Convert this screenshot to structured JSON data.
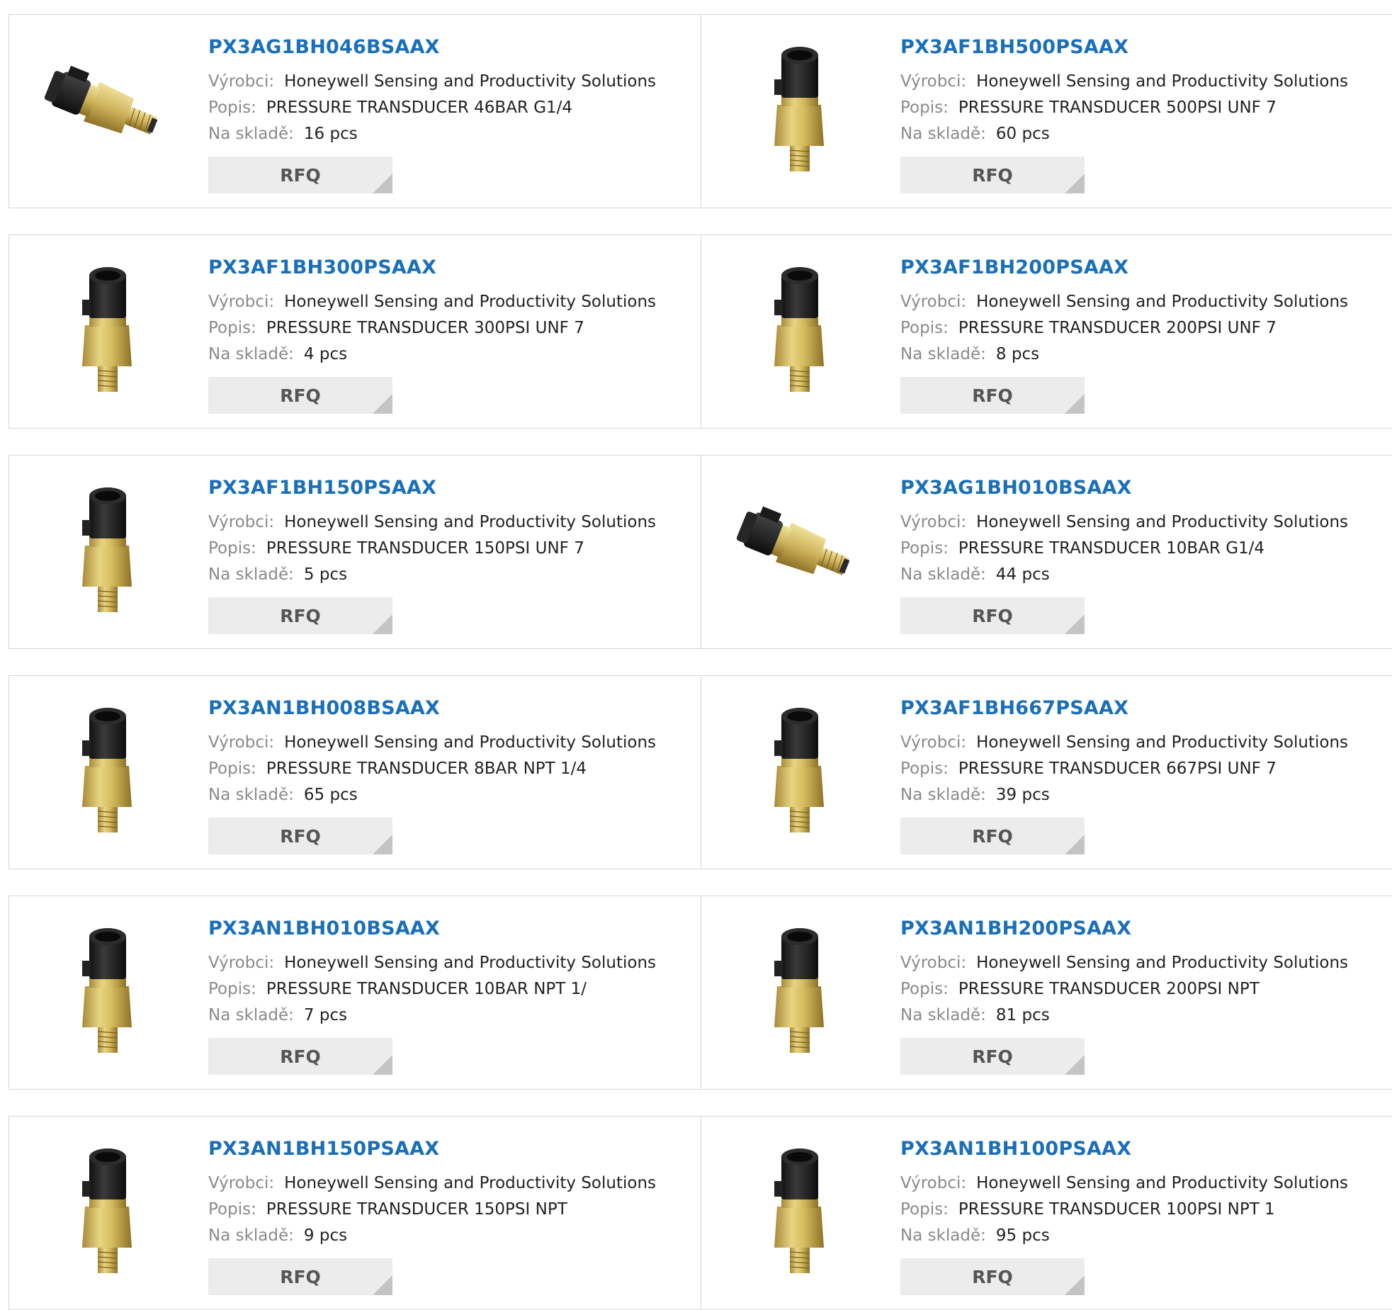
{
  "labels": {
    "manufacturer": "Výrobci:",
    "description": "Popis:",
    "stock": "Na skladě:",
    "rfq": "RFQ"
  },
  "products": [
    {
      "pn": "PX3AG1BH046BSAAX",
      "manufacturer": "Honeywell Sensing and Productivity Solutions",
      "description": "PRESSURE TRANSDUCER 46BAR G1/4",
      "stock": "16 pcs",
      "image": "pressure-sensor-side"
    },
    {
      "pn": "PX3AF1BH500PSAAX",
      "manufacturer": "Honeywell Sensing and Productivity Solutions",
      "description": "PRESSURE TRANSDUCER 500PSI UNF 7",
      "stock": "60 pcs",
      "image": "pressure-sensor-upright"
    },
    {
      "pn": "PX3AF1BH300PSAAX",
      "manufacturer": "Honeywell Sensing and Productivity Solutions",
      "description": "PRESSURE TRANSDUCER 300PSI UNF 7",
      "stock": "4 pcs",
      "image": "pressure-sensor-upright"
    },
    {
      "pn": "PX3AF1BH200PSAAX",
      "manufacturer": "Honeywell Sensing and Productivity Solutions",
      "description": "PRESSURE TRANSDUCER 200PSI UNF 7",
      "stock": "8 pcs",
      "image": "pressure-sensor-upright"
    },
    {
      "pn": "PX3AF1BH150PSAAX",
      "manufacturer": "Honeywell Sensing and Productivity Solutions",
      "description": "PRESSURE TRANSDUCER 150PSI UNF 7",
      "stock": "5 pcs",
      "image": "pressure-sensor-upright"
    },
    {
      "pn": "PX3AG1BH010BSAAX",
      "manufacturer": "Honeywell Sensing and Productivity Solutions",
      "description": "PRESSURE TRANSDUCER 10BAR G1/4",
      "stock": "44 pcs",
      "image": "pressure-sensor-side"
    },
    {
      "pn": "PX3AN1BH008BSAAX",
      "manufacturer": "Honeywell Sensing and Productivity Solutions",
      "description": "PRESSURE TRANSDUCER 8BAR NPT 1/4",
      "stock": "65 pcs",
      "image": "pressure-sensor-upright"
    },
    {
      "pn": "PX3AF1BH667PSAAX",
      "manufacturer": "Honeywell Sensing and Productivity Solutions",
      "description": "PRESSURE TRANSDUCER 667PSI UNF 7",
      "stock": "39 pcs",
      "image": "pressure-sensor-upright"
    },
    {
      "pn": "PX3AN1BH010BSAAX",
      "manufacturer": "Honeywell Sensing and Productivity Solutions",
      "description": "PRESSURE TRANSDUCER 10BAR NPT 1/",
      "stock": "7 pcs",
      "image": "pressure-sensor-upright"
    },
    {
      "pn": "PX3AN1BH200PSAAX",
      "manufacturer": "Honeywell Sensing and Productivity Solutions",
      "description": "PRESSURE TRANSDUCER 200PSI NPT",
      "stock": "81 pcs",
      "image": "pressure-sensor-upright"
    },
    {
      "pn": "PX3AN1BH150PSAAX",
      "manufacturer": "Honeywell Sensing and Productivity Solutions",
      "description": "PRESSURE TRANSDUCER 150PSI NPT",
      "stock": "9 pcs",
      "image": "pressure-sensor-upright"
    },
    {
      "pn": "PX3AN1BH100PSAAX",
      "manufacturer": "Honeywell Sensing and Productivity Solutions",
      "description": "PRESSURE TRANSDUCER 100PSI NPT 1",
      "stock": "95 pcs",
      "image": "pressure-sensor-upright"
    }
  ]
}
